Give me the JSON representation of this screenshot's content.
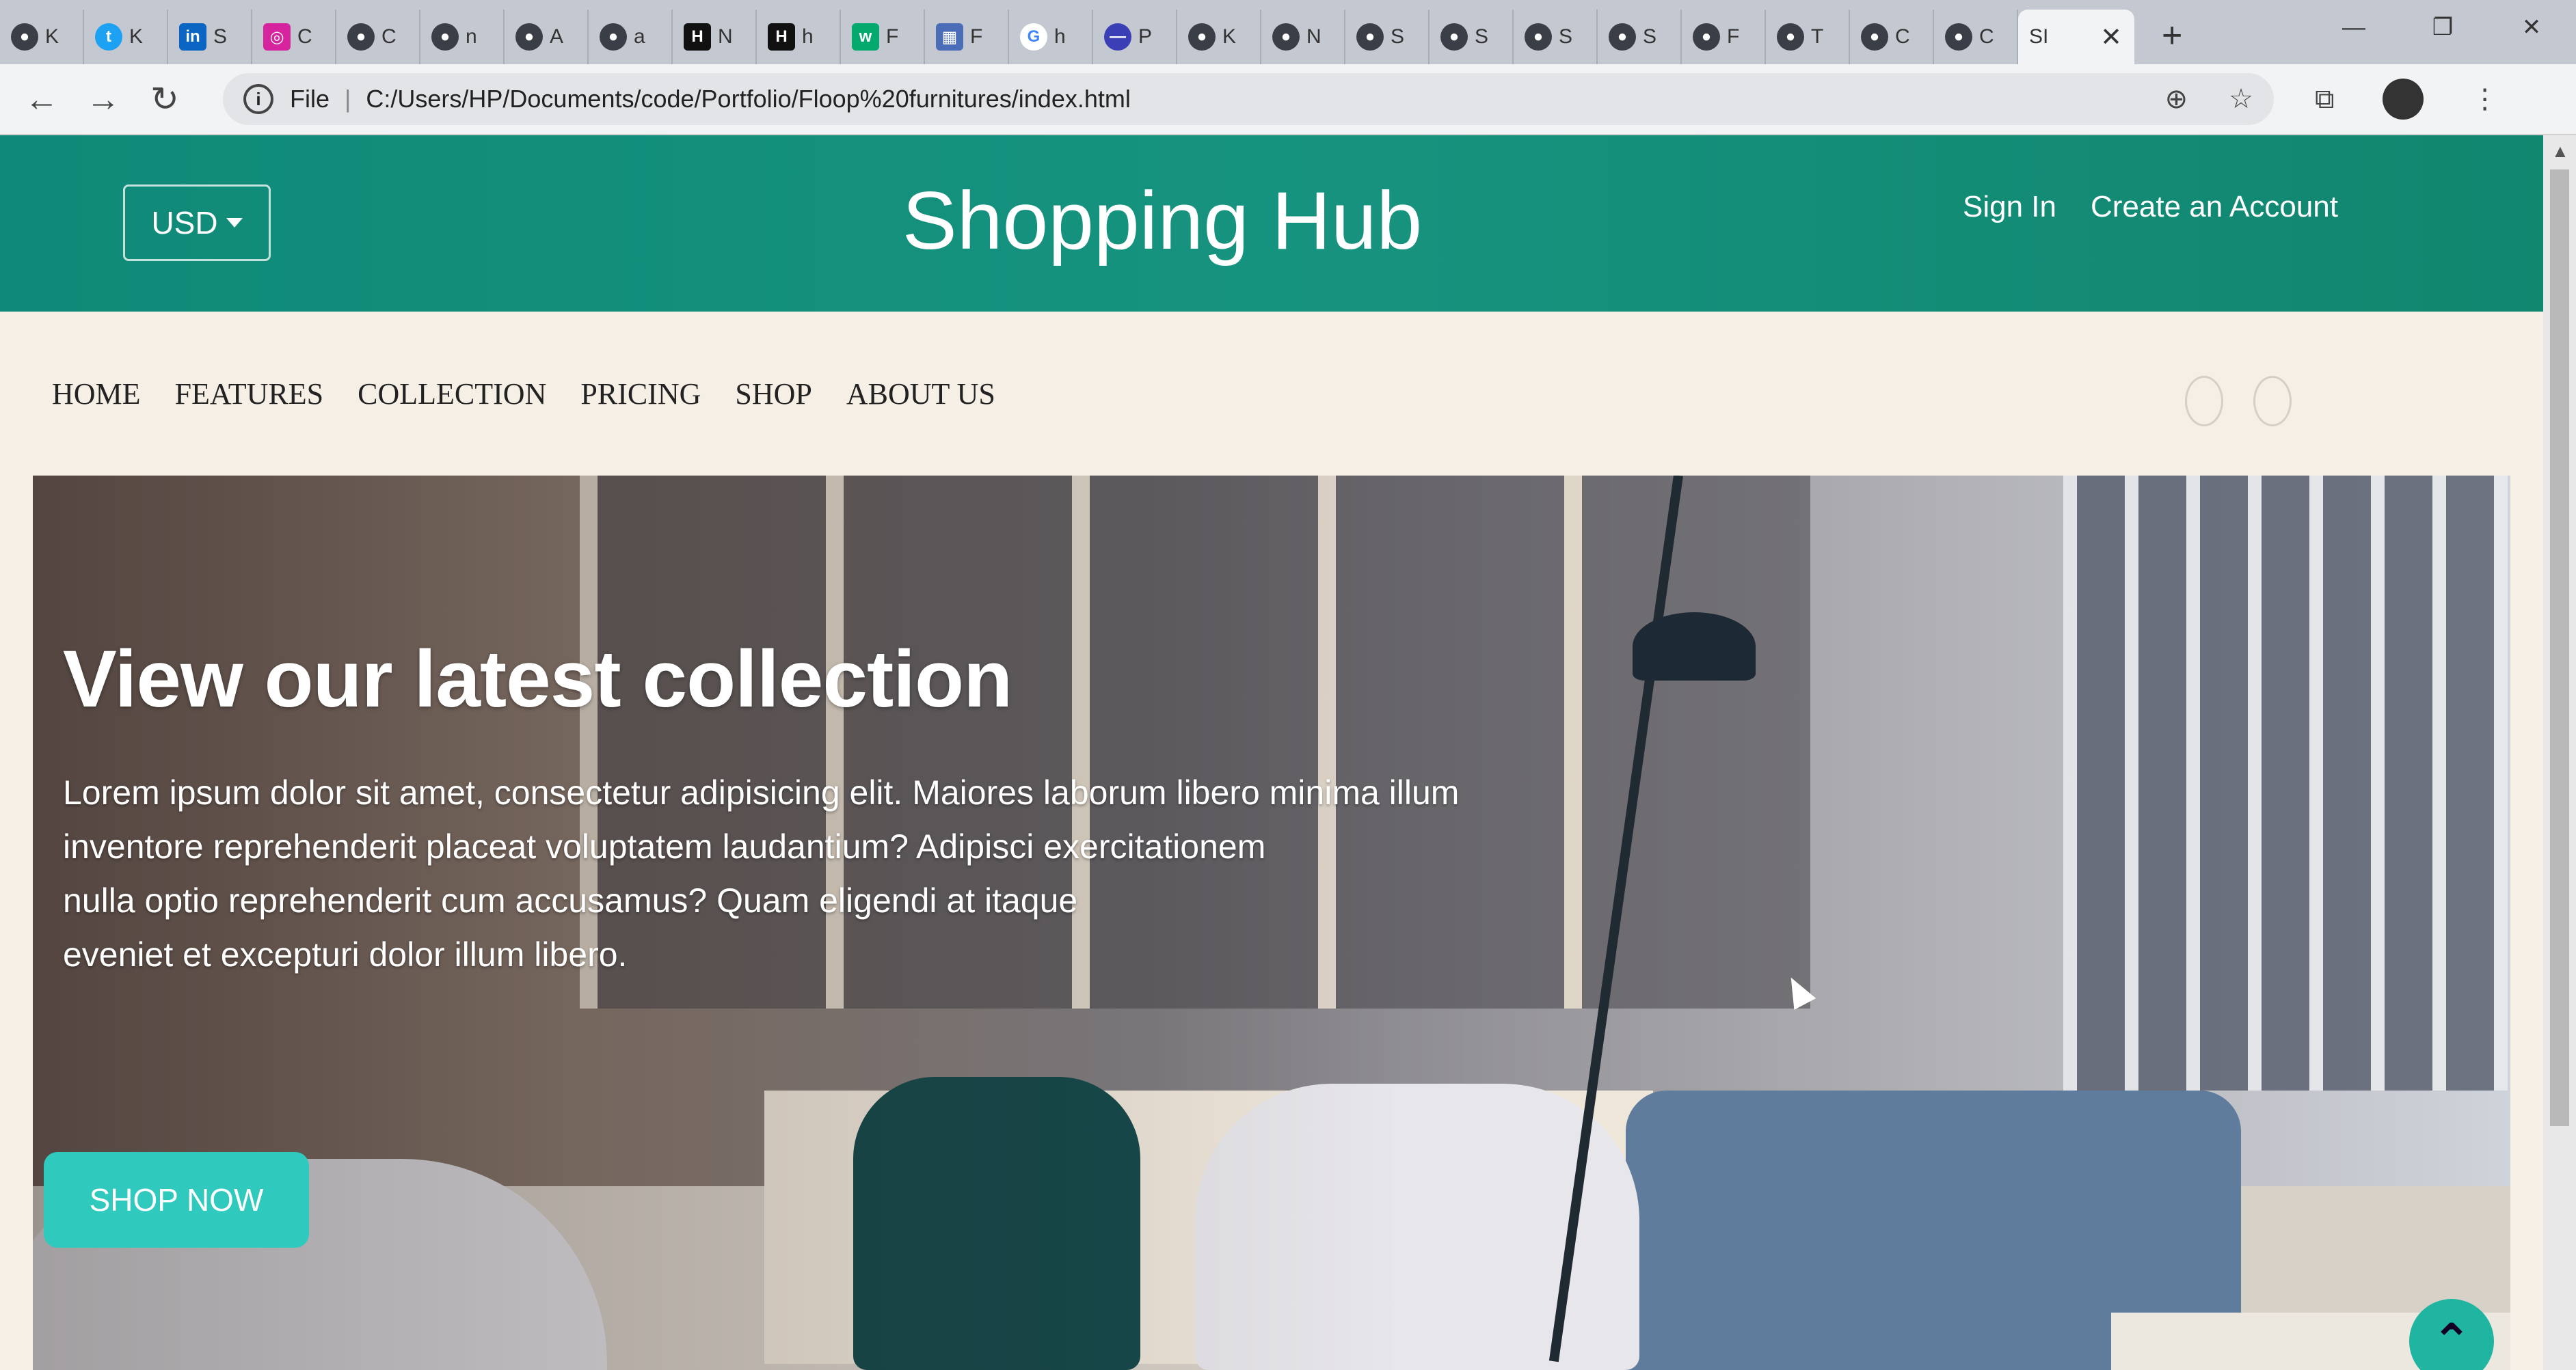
{
  "browser": {
    "tabs": [
      {
        "favicon": "globe-icon",
        "letter": "K"
      },
      {
        "favicon": "twitter-icon",
        "letter": "K"
      },
      {
        "favicon": "linkedin-icon",
        "letter": "S"
      },
      {
        "favicon": "instagram-icon",
        "letter": "C"
      },
      {
        "favicon": "globe-icon",
        "letter": "C"
      },
      {
        "favicon": "globe-icon",
        "letter": "n"
      },
      {
        "favicon": "globe-icon",
        "letter": "A"
      },
      {
        "favicon": "globe-icon",
        "letter": "a"
      },
      {
        "favicon": "hashnode-icon",
        "letter": "N"
      },
      {
        "favicon": "hashnode-icon",
        "letter": "h"
      },
      {
        "favicon": "w3-icon",
        "letter": "F"
      },
      {
        "favicon": "grid-icon",
        "letter": "F"
      },
      {
        "favicon": "google-icon",
        "letter": "h"
      },
      {
        "favicon": "circle-icon",
        "letter": "P"
      },
      {
        "favicon": "globe-icon",
        "letter": "K"
      },
      {
        "favicon": "globe-icon",
        "letter": "N"
      },
      {
        "favicon": "globe-icon",
        "letter": "S"
      },
      {
        "favicon": "globe-icon",
        "letter": "S"
      },
      {
        "favicon": "globe-icon",
        "letter": "S"
      },
      {
        "favicon": "globe-icon",
        "letter": "S"
      },
      {
        "favicon": "globe-icon",
        "letter": "F"
      },
      {
        "favicon": "globe-icon",
        "letter": "T"
      },
      {
        "favicon": "globe-icon",
        "letter": "C"
      },
      {
        "favicon": "globe-icon",
        "letter": "C"
      }
    ],
    "active_tab": {
      "label": "SI",
      "close": "✕"
    },
    "new_tab": "+",
    "window_controls": {
      "minimize": "—",
      "restore": "❐",
      "close": "✕"
    },
    "nav": {
      "back": "←",
      "forward": "→",
      "reload": "↻"
    },
    "address": {
      "scheme_label": "File",
      "url": "C:/Users/HP/Documents/code/Portfolio/Floop%20furnitures/index.html"
    },
    "omnibox_icons": {
      "zoom": "⊕",
      "bookmark": "☆"
    },
    "toolbar_icons": {
      "extension": "⧉",
      "menu": "⋮"
    }
  },
  "site": {
    "currency": "USD",
    "brand": "Shopping Hub",
    "account": {
      "sign_in": "Sign In",
      "create": "Create an Account"
    },
    "nav": [
      "HOME",
      "FEATURES",
      "COLLECTION",
      "PRICING",
      "SHOP",
      "ABOUT US"
    ],
    "hero": {
      "title": "View our latest collection",
      "body_lines": [
        "Lorem ipsum dolor sit amet, consectetur adipisicing elit. Maiores laborum libero minima illum",
        "inventore reprehenderit placeat voluptatem laudantium? Adipisci exercitationem",
        "nulla optio reprehenderit cum accusamus? Quam eligendi at itaque",
        "eveniet et excepturi dolor illum libero."
      ],
      "cta": "SHOP NOW"
    },
    "back_to_top": "⌃"
  },
  "colors": {
    "header": "#138b77",
    "cta": "#2fc9bd",
    "page_bg": "#f6efe6"
  }
}
